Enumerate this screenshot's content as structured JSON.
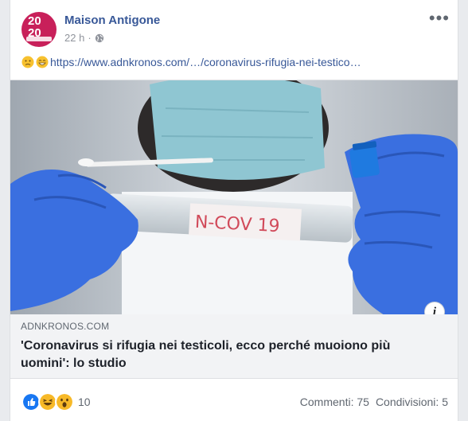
{
  "post": {
    "page_name": "Maison Antigone",
    "time": "22 h",
    "separator": "·",
    "avatar_text_top": "20",
    "avatar_text_bottom": "20",
    "link_text": "https://www.adnkronos.com/…/coronavirus-rifugia-nei-testico…",
    "emojis": [
      "slightly-frowning-face",
      "grinning-face"
    ]
  },
  "preview": {
    "domain": "ADNKRONOS.COM",
    "headline": "'Coronavirus si rifugia nei testicoli, ecco perché muoiono più uomini': lo studio",
    "image_label": "N-COV 19",
    "info_icon": "i"
  },
  "footer": {
    "reaction_count": "10",
    "comments": "Commenti: 75",
    "shares": "Condivisioni: 5",
    "reaction_icons": [
      "like",
      "haha",
      "wow"
    ]
  },
  "colors": {
    "brand_link": "#385898",
    "avatar_bg": "#c8205a",
    "glove_blue": "#3a6fe0",
    "like_blue": "#1877f2",
    "reaction_yellow": "#f7b928"
  }
}
